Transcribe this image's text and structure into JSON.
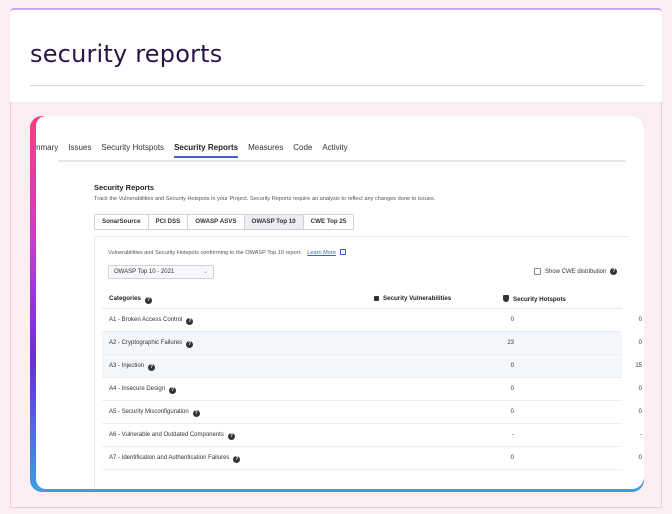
{
  "page": {
    "title": "security reports"
  },
  "nav": {
    "items": [
      {
        "label": "Summary",
        "active": false
      },
      {
        "label": "Issues",
        "active": false
      },
      {
        "label": "Security Hotspots",
        "active": false
      },
      {
        "label": "Security Reports",
        "active": true
      },
      {
        "label": "Measures",
        "active": false
      },
      {
        "label": "Code",
        "active": false
      },
      {
        "label": "Activity",
        "active": false
      }
    ]
  },
  "section": {
    "title": "Security Reports",
    "description": "Track the Vulnerabilities and Security Hotspots in your Project. Security Reports require an analysis to reflect any changes done to issues."
  },
  "tabs": [
    {
      "label": "SonarSource",
      "active": false
    },
    {
      "label": "PCI DSS",
      "active": false
    },
    {
      "label": "OWASP ASVS",
      "active": false
    },
    {
      "label": "OWASP Top 10",
      "active": true
    },
    {
      "label": "CWE Top 25",
      "active": false
    }
  ],
  "panel": {
    "description": "Vulnerabilities and Security Hotspots conforming to the OWASP Top 10 report.",
    "learn_more": "Learn More",
    "select_value": "OWASP Top 10 - 2021",
    "cwe_label": "Show CWE distribution"
  },
  "table": {
    "headers": {
      "categories": "Categories",
      "vulnerabilities": "Security Vulnerabilities",
      "hotspots": "Security Hotspots"
    },
    "rows": [
      {
        "category": "A1 - Broken Access Control",
        "vulnerabilities": "0",
        "hotspots": "0"
      },
      {
        "category": "A2 - Cryptographic Failures",
        "vulnerabilities": "23",
        "hotspots": "0"
      },
      {
        "category": "A3 - Injection",
        "vulnerabilities": "0",
        "hotspots": "15"
      },
      {
        "category": "A4 - Insecure Design",
        "vulnerabilities": "0",
        "hotspots": "0"
      },
      {
        "category": "A5 - Security Misconfiguration",
        "vulnerabilities": "0",
        "hotspots": "0"
      },
      {
        "category": "A6 - Vulnerable and Outdated Components",
        "vulnerabilities": "-",
        "hotspots": "-"
      },
      {
        "category": "A7 - Identification and Authentication Failures",
        "vulnerabilities": "0",
        "hotspots": "0"
      }
    ]
  },
  "colors": {
    "accent": "#3a62c9",
    "title": "#2a1547",
    "row_highlight": "#f3f7fc"
  }
}
